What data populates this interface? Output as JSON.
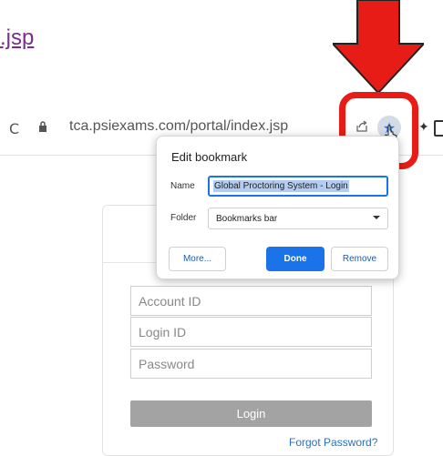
{
  "page": {
    "link_text": ".jsp"
  },
  "browser": {
    "url": "tca.psiexams.com/portal/index.jsp",
    "icons": [
      "reload-icon",
      "lock-icon",
      "share-icon",
      "star-icon",
      "close-icon",
      "extensions-icon",
      "side-panel-icon"
    ],
    "reload_glyph": "C",
    "close_glyph": "×",
    "star_glyph": "★",
    "star_color": "#1a73e8"
  },
  "annotation": {
    "arrow_color": "#e81c16",
    "box_color": "#e81c16"
  },
  "bookmark_dialog": {
    "title": "Edit bookmark",
    "name_label": "Name",
    "name_value": "Global Proctoring System - Login",
    "folder_label": "Folder",
    "folder_value": "Bookmarks bar",
    "more_label": "More...",
    "done_label": "Done",
    "remove_label": "Remove"
  },
  "login": {
    "account_placeholder": "Account ID",
    "login_id_placeholder": "Login ID",
    "password_placeholder": "Password",
    "login_button": "Login",
    "forgot_link": "Forgot Password?"
  }
}
